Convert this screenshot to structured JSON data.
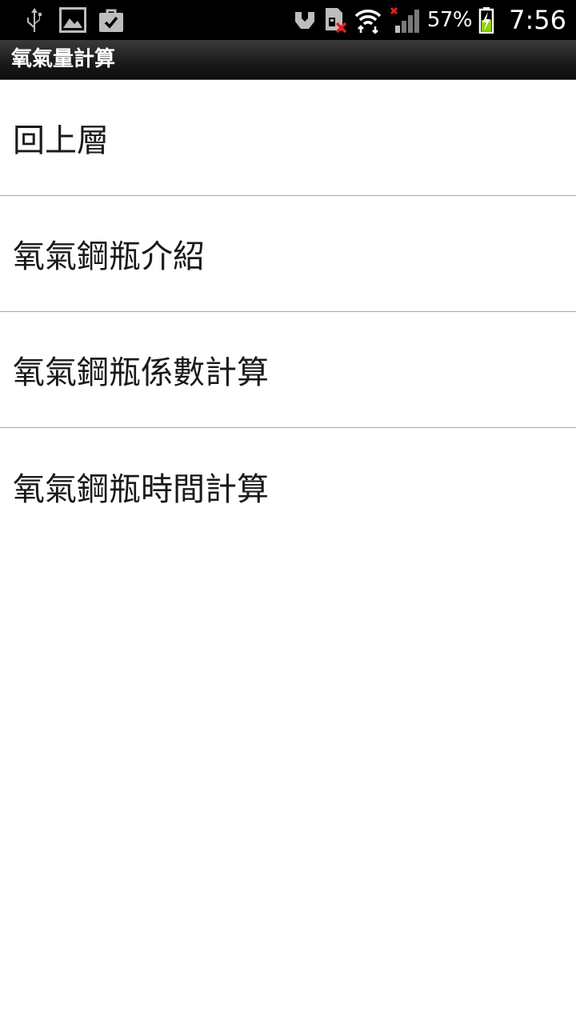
{
  "status_bar": {
    "left_icons": [
      "usb-icon",
      "image-icon",
      "shopping-bag-check-icon"
    ],
    "right_icons": [
      "vpn-key-icon",
      "sim-error-icon",
      "wifi-icon",
      "signal-icon",
      "battery-charging-icon"
    ],
    "battery_percent": "57%",
    "time": "7:56"
  },
  "title_bar": {
    "title": "氧氣量計算"
  },
  "menu": {
    "items": [
      {
        "label": "回上層"
      },
      {
        "label": "氧氣鋼瓶介紹"
      },
      {
        "label": "氧氣鋼瓶係數計算"
      },
      {
        "label": "氧氣鋼瓶時間計算"
      }
    ]
  },
  "colors": {
    "status_bar_bg": "#000000",
    "title_bar_bg": "#1a1a1a",
    "list_bg": "#ffffff",
    "divider": "#a8a8a8",
    "text": "#1a1a1a",
    "error_red": "#e02020",
    "battery_green": "#8fd400"
  }
}
